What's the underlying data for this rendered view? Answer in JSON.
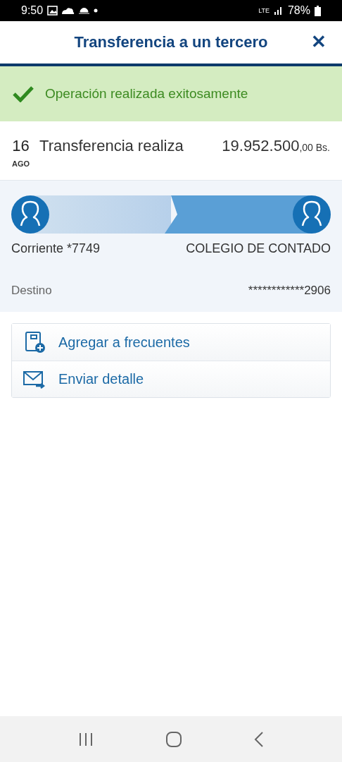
{
  "status_bar": {
    "time": "9:50",
    "network": "LTE",
    "battery": "78%"
  },
  "header": {
    "title": "Transferencia a un tercero",
    "close": "✕"
  },
  "banner": {
    "message": "Operación realizada exitosamente"
  },
  "transaction": {
    "day": "16",
    "month": "AGO",
    "description": "Transferencia realiza",
    "amount": "19.952.500",
    "decimals": ",00",
    "currency": "Bs."
  },
  "transfer": {
    "origin_account": "Corriente *7749",
    "destination_name": "COLEGIO DE CONTADO",
    "destination_label": "Destino",
    "destination_account": "************2906"
  },
  "actions": [
    {
      "kind": "favorite",
      "label": "Agregar a frecuentes"
    },
    {
      "kind": "send",
      "label": "Enviar detalle"
    }
  ]
}
